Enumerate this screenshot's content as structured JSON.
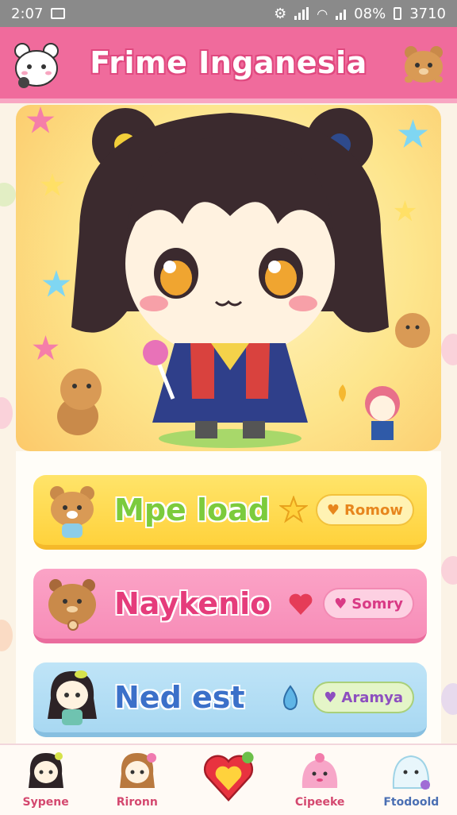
{
  "status_bar": {
    "time": "2:07",
    "battery": "08%",
    "extra": "3710"
  },
  "header": {
    "title": "Frime Inganesia"
  },
  "cards": [
    {
      "label": "Mpe load",
      "button": "Romow"
    },
    {
      "label": "Naykenio",
      "button": "Somry"
    },
    {
      "label": "Ned est",
      "button": "Aramya"
    }
  ],
  "bottom_nav": [
    {
      "label": "Sypene"
    },
    {
      "label": "Rironn"
    },
    {
      "label": ""
    },
    {
      "label": "Cipeeke"
    },
    {
      "label": "Ftodoold"
    }
  ],
  "colors": {
    "header": "#f06b9c",
    "card_yellow": "#ffd23c",
    "card_pink": "#f78db8",
    "card_blue": "#a8d8f2"
  },
  "icons": [
    "notification-icon",
    "signal-icon",
    "wifi-icon",
    "battery-icon",
    "heart-icon",
    "star-icon"
  ]
}
